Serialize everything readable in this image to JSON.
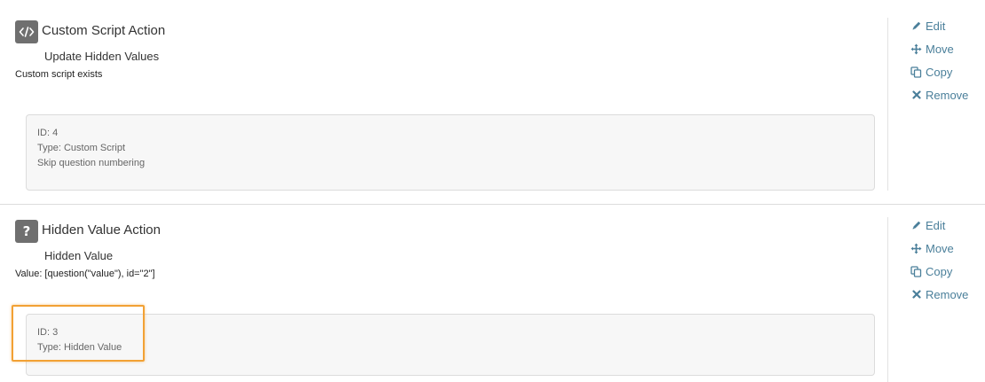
{
  "colors": {
    "link": "#4a7f9a",
    "icon_bg": "#6f6f6f",
    "highlight": "#f2a134"
  },
  "actions": [
    {
      "icon": "code-icon",
      "type_title": "Custom Script Action",
      "name": "Update Hidden Values",
      "description": "Custom script exists",
      "info": {
        "id": "ID: 4",
        "type": "Type: Custom Script",
        "extra": "Skip question numbering"
      }
    },
    {
      "icon": "question-icon",
      "icon_glyph": "?",
      "type_title": "Hidden Value Action",
      "name": "Hidden Value",
      "description": "Value: [question(\"value\"), id=\"2\"]",
      "info": {
        "id": "ID: 3",
        "type": "Type: Hidden Value"
      }
    }
  ],
  "menu": {
    "edit": "Edit",
    "move": "Move",
    "copy": "Copy",
    "remove": "Remove"
  }
}
